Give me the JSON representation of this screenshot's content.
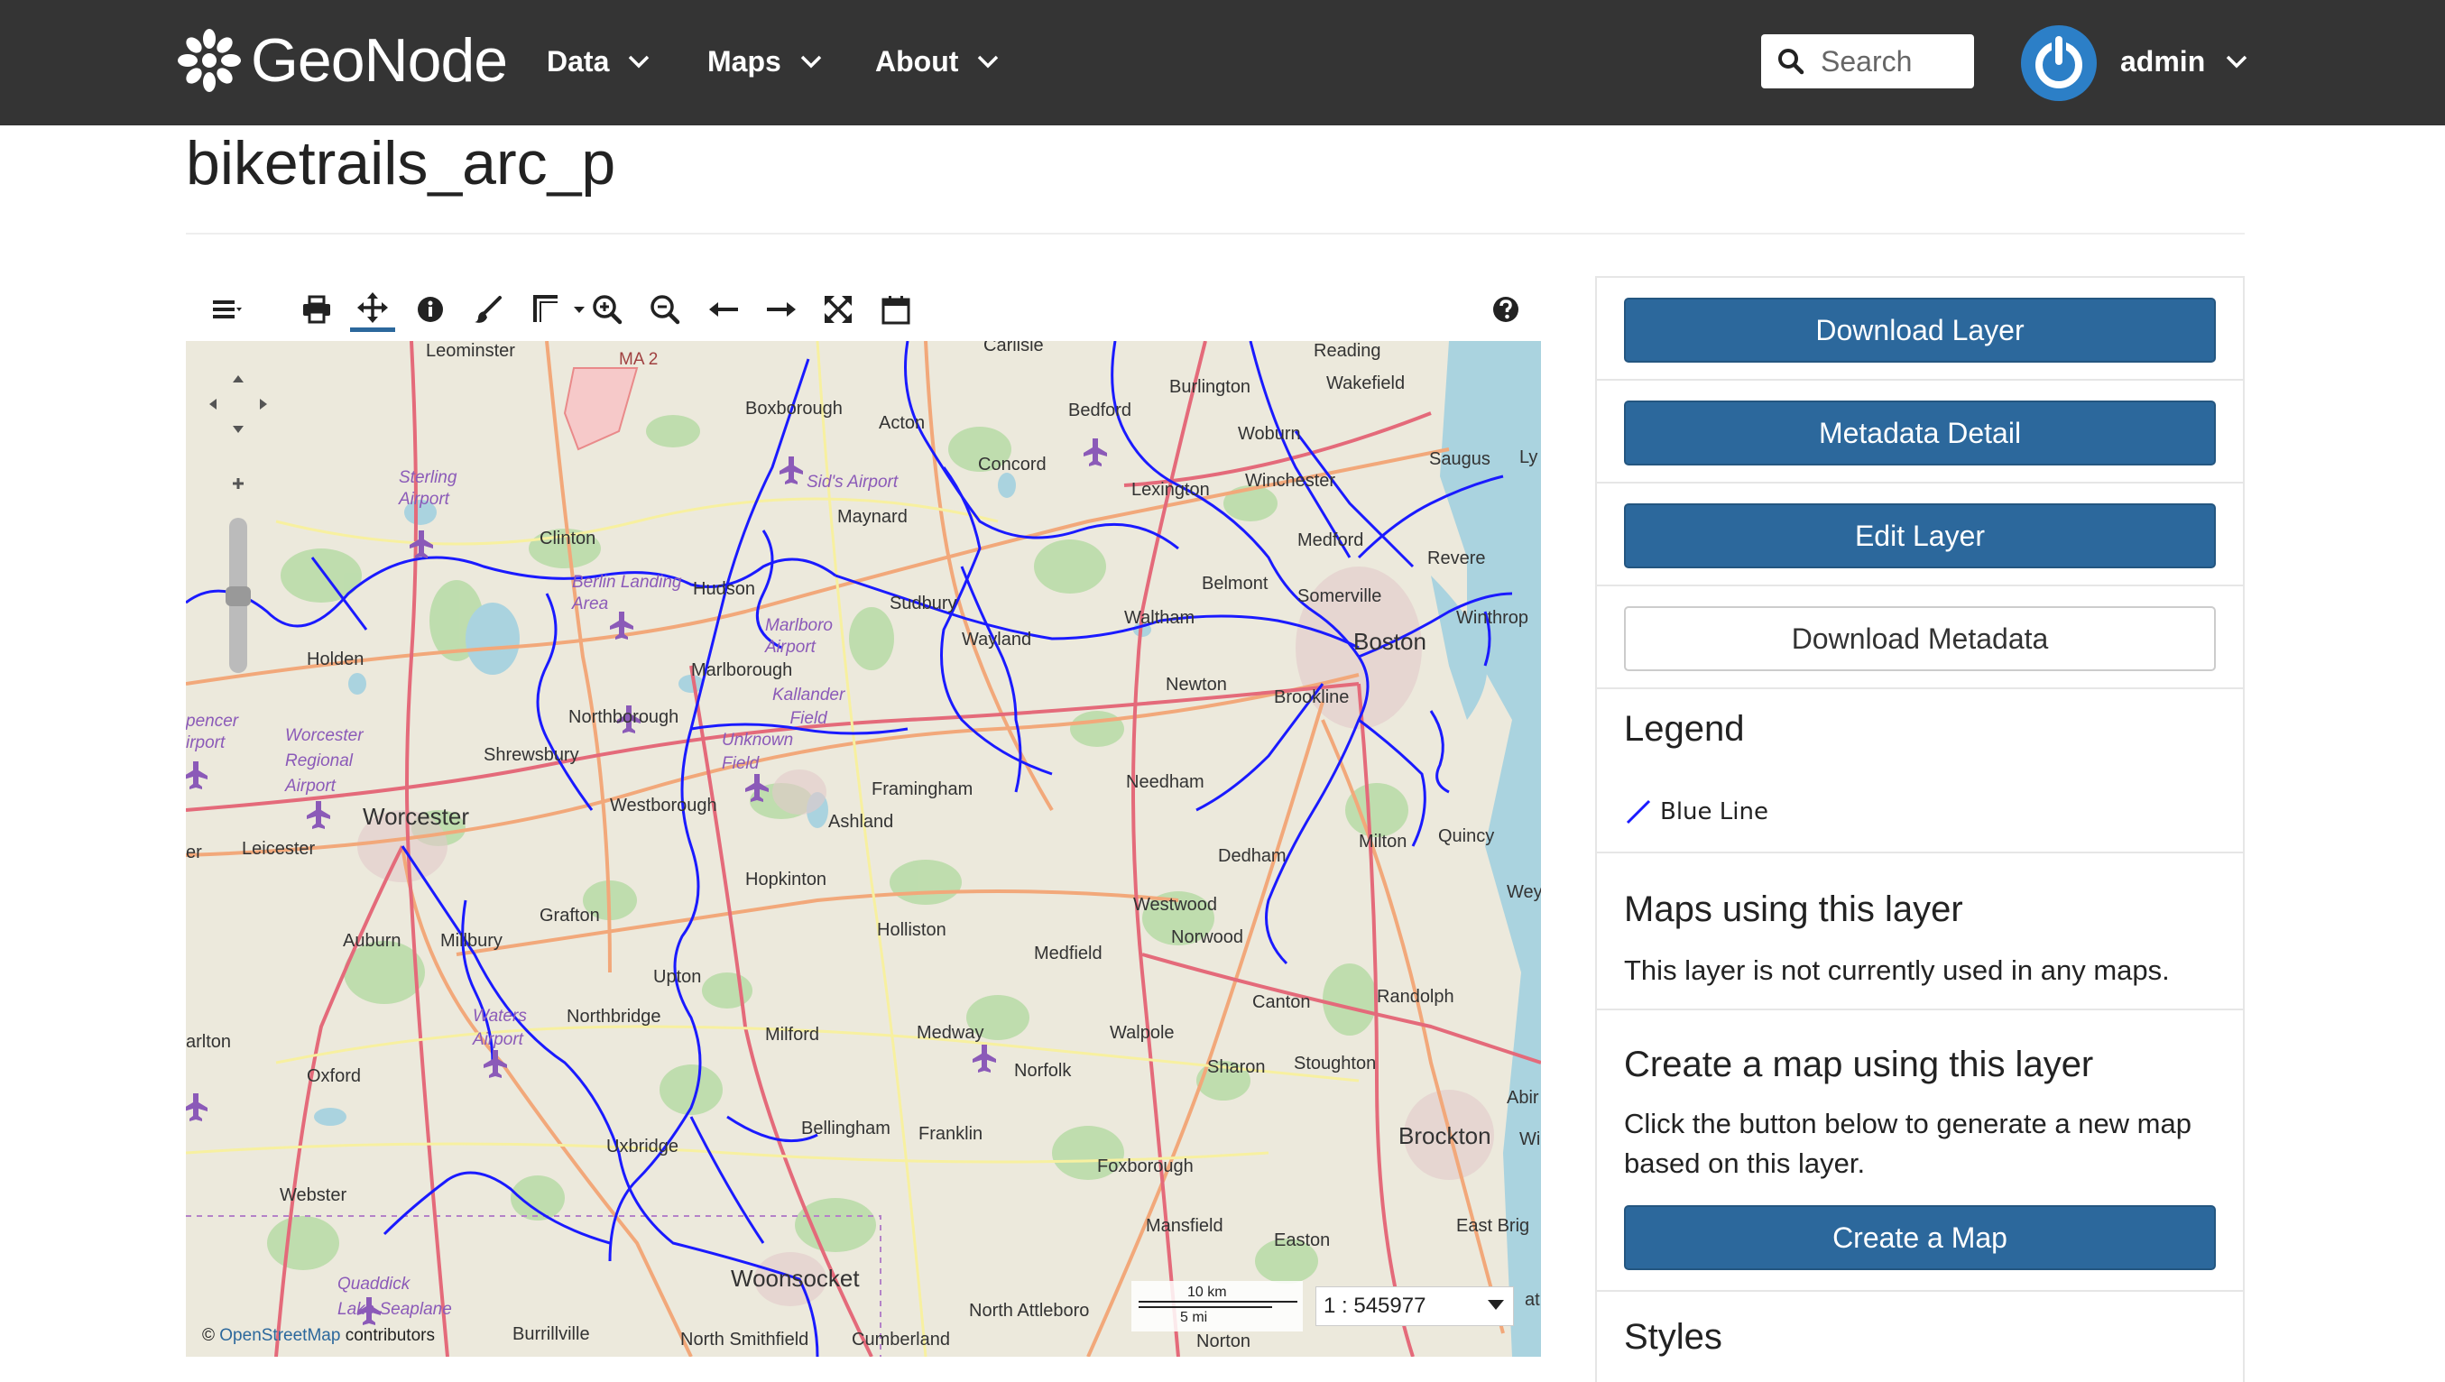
{
  "navbar": {
    "brand": "GeoNode",
    "menu": [
      {
        "label": "Data"
      },
      {
        "label": "Maps"
      },
      {
        "label": "About"
      }
    ],
    "search_placeholder": "Search",
    "user": "admin"
  },
  "page": {
    "title": "biketrails_arc_p"
  },
  "map": {
    "toolbar_icons": [
      "menu-icon",
      "print-icon",
      "pan-icon",
      "info-icon",
      "draw-icon",
      "measure-icon",
      "zoom-in-icon",
      "zoom-out-icon",
      "back-icon",
      "forward-icon",
      "fullscreen-icon",
      "calendar-icon",
      "help-icon"
    ],
    "attribution_prefix": "©",
    "attribution_link": "OpenStreetMap",
    "attribution_suffix": "contributors",
    "scale_km": "10 km",
    "scale_mi": "5 mi",
    "scale_ratio": "1 : 545977",
    "labels": {
      "leominster": "Leominster",
      "ma2": "MA 2",
      "carlisle": "Carlisle",
      "reading": "Reading",
      "burlington": "Burlington",
      "wakefield": "Wakefield",
      "boxborough": "Boxborough",
      "acton": "Acton",
      "bedford": "Bedford",
      "woburn": "Woburn",
      "saugus": "Saugus",
      "lyn": "Ly",
      "sterling_airport": "Sterling\nAirport",
      "sids_airport": "Sid's Airport",
      "concord": "Concord",
      "lexington": "Lexington",
      "winchester": "Winchester",
      "maynard": "Maynard",
      "clinton": "Clinton",
      "medford": "Medford",
      "revere": "Revere",
      "berlin_landing": "Berlin Landing\nArea",
      "hudson": "Hudson",
      "sudbury": "Sudbury",
      "belmont": "Belmont",
      "somerville": "Somerville",
      "winthrop": "Winthrop",
      "marlboro_airport": "Marlboro\nAirport",
      "wayland": "Wayland",
      "waltham": "Waltham",
      "boston": "Boston",
      "holden": "Holden",
      "marlborough": "Marlborough",
      "kallander_field": "Kallander\nField",
      "newton": "Newton",
      "brookline": "Brookline",
      "spencer_airport": "pencer\nirport",
      "worcester_regional": "Worcester\nRegional\nAirport",
      "northborough": "Northborough",
      "unknown_field": "Unknown\nField",
      "shrewsbury": "Shrewsbury",
      "framingham": "Framingham",
      "needham": "Needham",
      "worcester": "Worcester",
      "westborough": "Westborough",
      "ashland": "Ashland",
      "milton": "Milton",
      "quincy": "Quincy",
      "er": "er",
      "leicester": "Leicester",
      "dedham": "Dedham",
      "hopkinton": "Hopkinton",
      "westwood": "Westwood",
      "wey": "Wey",
      "grafton": "Grafton",
      "norwood": "Norwood",
      "auburn": "Auburn",
      "millbury": "Millbury",
      "holliston": "Holliston",
      "medfield": "Medfield",
      "randolph": "Randolph",
      "upton": "Upton",
      "canton": "Canton",
      "waters_airport": "Waters\nAirport",
      "northbridge": "Northbridge",
      "milford": "Milford",
      "medway": "Medway",
      "walpole": "Walpole",
      "arlton": "arlton",
      "sharon": "Sharon",
      "stoughton": "Stoughton",
      "oxford": "Oxford",
      "norfolk": "Norfolk",
      "abir": "Abir",
      "bellingham": "Bellingham",
      "franklin": "Franklin",
      "brockton": "Brockton",
      "wi": "Wi",
      "uxbridge": "Uxbridge",
      "foxborough": "Foxborough",
      "webster": "Webster",
      "mansfield": "Mansfield",
      "east_brig": "East Brig",
      "easton": "Easton",
      "woonsocket": "Woonsocket",
      "quaddick": "Quaddick\nLake Seaplane",
      "burrillville": "Burrillville",
      "north_attleboro": "North Attleboro",
      "north_smithfield": "North Smithfield",
      "cumberland": "Cumberland",
      "norton": "Norton",
      "at": "at"
    }
  },
  "sidebar": {
    "buttons": {
      "download_layer": "Download Layer",
      "metadata_detail": "Metadata Detail",
      "edit_layer": "Edit Layer",
      "download_metadata": "Download Metadata"
    },
    "legend": {
      "heading": "Legend",
      "item": "Blue Line",
      "color": "#1a1aff"
    },
    "maps_using": {
      "heading": "Maps using this layer",
      "text": "This layer is not currently used in any maps."
    },
    "create_map": {
      "heading": "Create a map using this layer",
      "text": "Click the button below to generate a new map based on this layer.",
      "button": "Create a Map"
    },
    "styles": {
      "heading": "Styles"
    }
  },
  "colors": {
    "navbar_bg": "#343434",
    "primary": "#2c689c",
    "trail": "#1a1aff"
  }
}
